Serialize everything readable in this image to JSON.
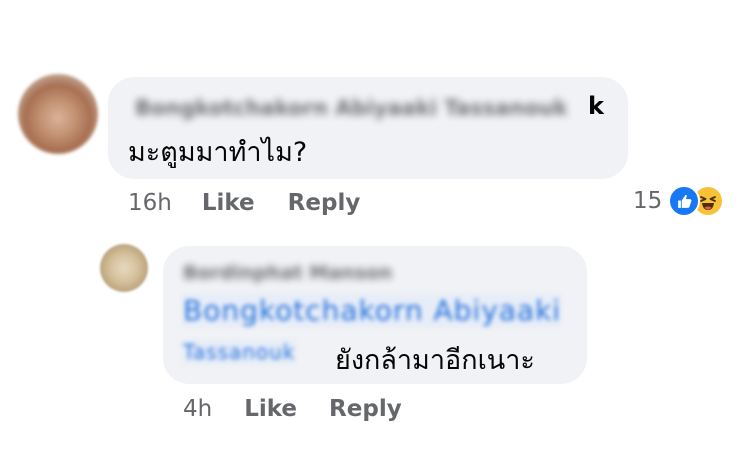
{
  "comment": {
    "author_visible_tail": "k",
    "author_blurred": "Bongkotchakorn Abiyaaki Tassanouk",
    "text": "มะตูมมาทำไม?",
    "time": "16h",
    "like_label": "Like",
    "reply_label": "Reply",
    "reaction_count": "15",
    "reactions": [
      "like-icon",
      "haha-icon"
    ]
  },
  "reply": {
    "author_blurred": "Bordinphat Manson",
    "tag_line1_blurred": "Bongkotchakorn Abiyaaki",
    "tag_line2_blurred": "Tassanouk",
    "text": "ยังกล้ามาอีกเนาะ",
    "time": "4h",
    "like_label": "Like",
    "reply_label": "Reply"
  },
  "colors": {
    "bubble": "#f0f2f5",
    "secondary_text": "#65676b",
    "link": "#216fdb",
    "like_blue": "#1877f2",
    "haha_yellow": "#f7c23a"
  }
}
